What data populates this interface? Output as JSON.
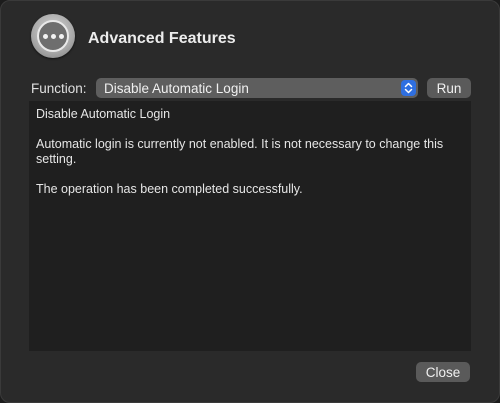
{
  "window": {
    "title": "Advanced Features",
    "app_icon": "ellipsis-icon"
  },
  "function_row": {
    "label": "Function:",
    "selected": "Disable Automatic Login",
    "run_label": "Run"
  },
  "output": {
    "lines": [
      "Disable Automatic Login",
      "Automatic login is currently not enabled. It is not necessary to change this setting.",
      "The operation has been completed successfully."
    ]
  },
  "footer": {
    "close_label": "Close"
  },
  "colors": {
    "window_bg": "#2a2a2a",
    "output_bg": "#1f1f1f",
    "button_bg": "#5a5a5a",
    "accent": "#2f6fe0"
  }
}
